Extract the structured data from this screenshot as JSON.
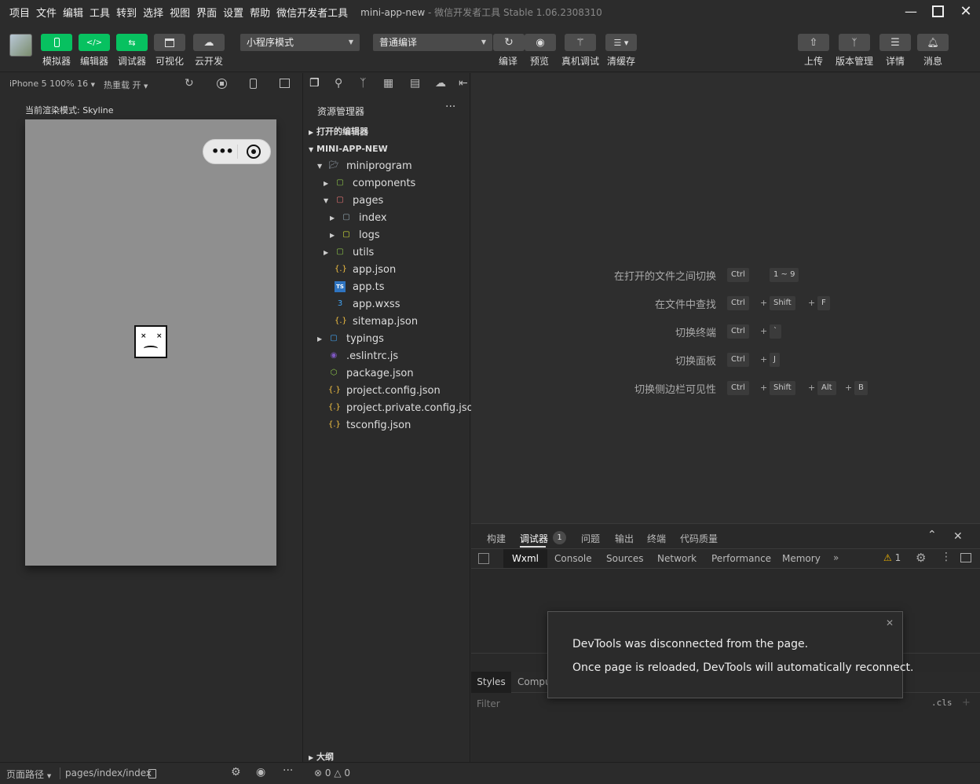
{
  "menubar": {
    "items": [
      "项目",
      "文件",
      "编辑",
      "工具",
      "转到",
      "选择",
      "视图",
      "界面",
      "设置",
      "帮助",
      "微信开发者工具"
    ],
    "title": "mini-app-new",
    "title_sub": " - 微信开发者工具 Stable 1.06.2308310"
  },
  "toolbar": {
    "simulator": "模拟器",
    "editor": "编辑器",
    "debugger": "调试器",
    "visual": "可视化",
    "cloud": "云开发",
    "mode": "小程序模式",
    "compile_mode": "普通编译",
    "compile": "编译",
    "preview": "预览",
    "real_debug": "真机调试",
    "clear_cache": "清缓存",
    "upload": "上传",
    "version": "版本管理",
    "details": "详情",
    "messages": "消息"
  },
  "simulator": {
    "device": "iPhone 5 100% 16",
    "hot_reload": "热重载 开",
    "render_mode": "当前渲染模式: Skyline"
  },
  "explorer": {
    "title": "资源管理器",
    "open_editors": "打开的编辑器",
    "project": "MINI-APP-NEW",
    "outline": "大纲",
    "tree": [
      {
        "name": "miniprogram",
        "kind": "folder-open",
        "depth": 1,
        "arrow": "down"
      },
      {
        "name": "components",
        "kind": "folder-green",
        "depth": 2,
        "arrow": "right"
      },
      {
        "name": "pages",
        "kind": "folder-red",
        "depth": 2,
        "arrow": "down"
      },
      {
        "name": "index",
        "kind": "folder",
        "depth": 3,
        "arrow": "right"
      },
      {
        "name": "logs",
        "kind": "folder-yellow",
        "depth": 3,
        "arrow": "right"
      },
      {
        "name": "utils",
        "kind": "folder-green",
        "depth": 2,
        "arrow": "right"
      },
      {
        "name": "app.json",
        "kind": "json",
        "depth": 2,
        "arrow": ""
      },
      {
        "name": "app.ts",
        "kind": "ts",
        "depth": 2,
        "arrow": ""
      },
      {
        "name": "app.wxss",
        "kind": "css",
        "depth": 2,
        "arrow": ""
      },
      {
        "name": "sitemap.json",
        "kind": "json",
        "depth": 2,
        "arrow": ""
      },
      {
        "name": "typings",
        "kind": "folder-ts",
        "depth": 1,
        "arrow": "right"
      },
      {
        "name": ".eslintrc.js",
        "kind": "eslint",
        "depth": 1,
        "arrow": ""
      },
      {
        "name": "package.json",
        "kind": "npm",
        "depth": 1,
        "arrow": ""
      },
      {
        "name": "project.config.json",
        "kind": "json",
        "depth": 1,
        "arrow": ""
      },
      {
        "name": "project.private.config.json",
        "kind": "json",
        "depth": 1,
        "arrow": ""
      },
      {
        "name": "tsconfig.json",
        "kind": "json",
        "depth": 1,
        "arrow": ""
      }
    ]
  },
  "editor_hints": [
    {
      "label": "在打开的文件之间切换",
      "keys": [
        "Ctrl",
        "1 ~ 9"
      ],
      "sep": [
        " "
      ]
    },
    {
      "label": "在文件中查找",
      "keys": [
        "Ctrl",
        "Shift",
        "F"
      ],
      "sep": [
        "+",
        "+"
      ]
    },
    {
      "label": "切换终端",
      "keys": [
        "Ctrl",
        "`"
      ],
      "sep": [
        "+"
      ]
    },
    {
      "label": "切换面板",
      "keys": [
        "Ctrl",
        "J"
      ],
      "sep": [
        "+"
      ]
    },
    {
      "label": "切换侧边栏可见性",
      "keys": [
        "Ctrl",
        "Shift",
        "Alt",
        "B"
      ],
      "sep": [
        "+",
        "+",
        "+"
      ]
    }
  ],
  "panel": {
    "tabs": [
      "构建",
      "调试器",
      "问题",
      "输出",
      "终端",
      "代码质量"
    ],
    "debugger_badge": "1",
    "devtools_tabs": [
      "Wxml",
      "Console",
      "Sources",
      "Network",
      "Performance",
      "Memory"
    ],
    "more": "»",
    "warn_count": "1",
    "styles_tab": "Styles",
    "computed_tab": "Compu",
    "filter_placeholder": "Filter",
    "cls": ".cls"
  },
  "toast": {
    "line1": "DevTools was disconnected from the page.",
    "line2": "Once page is reloaded, DevTools will automatically reconnect."
  },
  "statusbar": {
    "page_path_label": "页面路径",
    "page_path": "pages/index/index",
    "errors": "0",
    "warnings": "0"
  }
}
